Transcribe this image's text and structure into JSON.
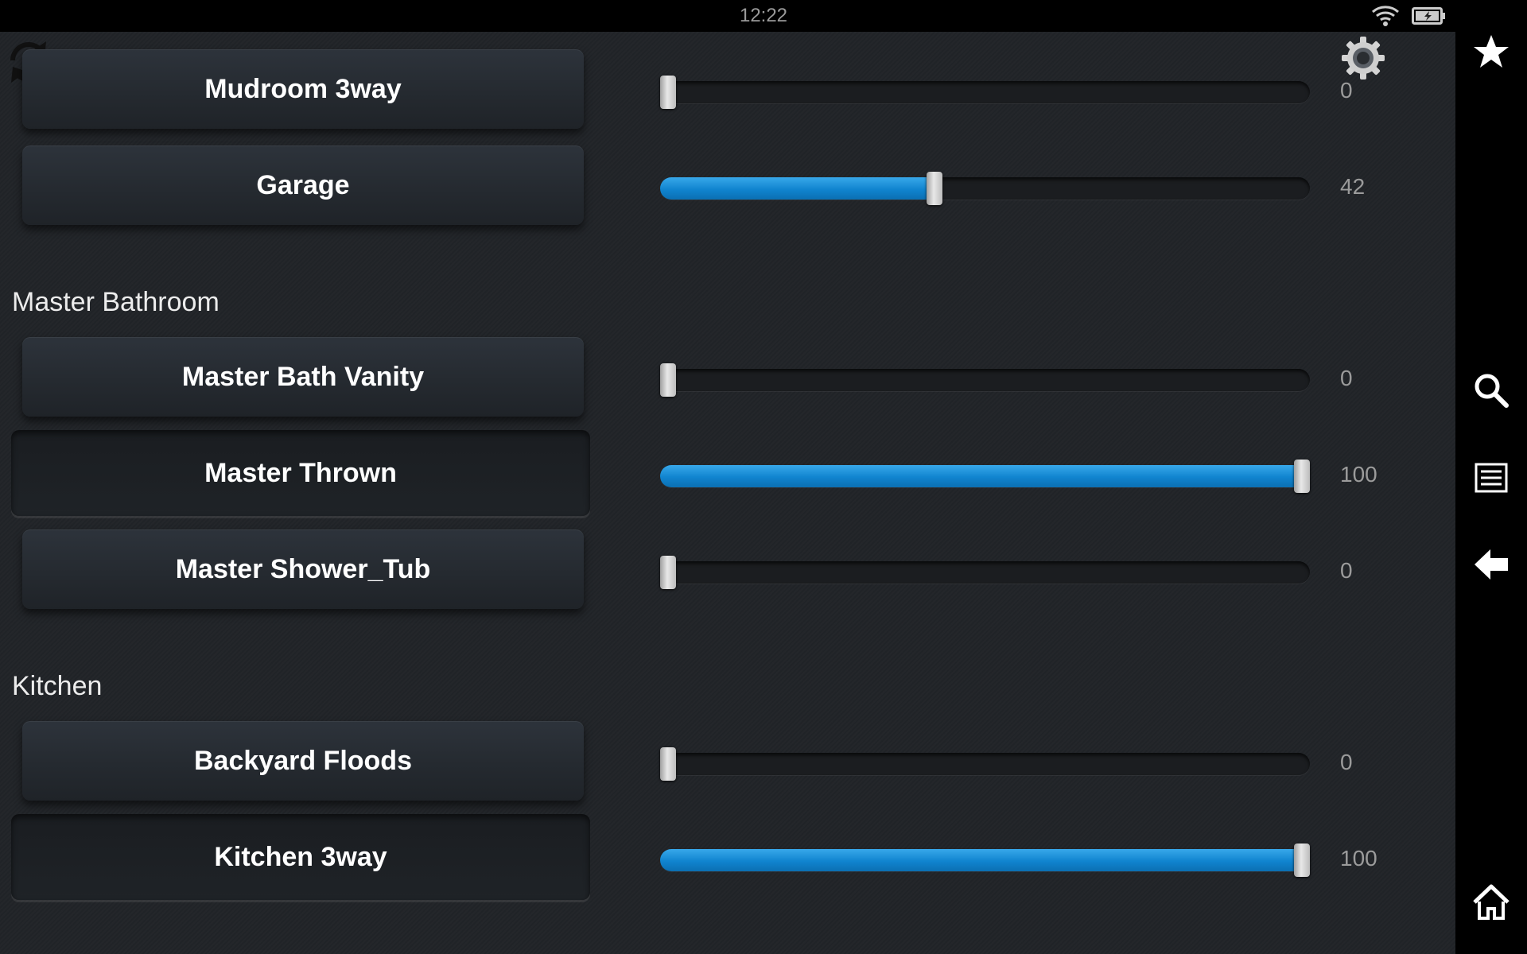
{
  "status_bar": {
    "time": "12:22"
  },
  "groups": [
    {
      "section": "",
      "items": [
        {
          "name": "Mudroom 3way",
          "level": 0,
          "value_text": "0"
        },
        {
          "name": "Garage",
          "level": 42,
          "value_text": "42"
        }
      ]
    },
    {
      "section": "Master Bathroom",
      "items": [
        {
          "name": "Master Bath Vanity",
          "level": 0,
          "value_text": "0"
        },
        {
          "name": "Master Thrown",
          "level": 100,
          "value_text": "100",
          "pressed": true
        },
        {
          "name": "Master Shower_Tub",
          "level": 0,
          "value_text": "0"
        }
      ]
    },
    {
      "section": "Kitchen",
      "items": [
        {
          "name": "Backyard Floods",
          "level": 0,
          "value_text": "0"
        },
        {
          "name": "Kitchen 3way",
          "level": 100,
          "value_text": "100",
          "pressed": true
        }
      ]
    }
  ],
  "icons": {
    "refresh": "refresh-icon",
    "settings": "gear-icon",
    "wifi": "wifi-icon",
    "battery": "battery-icon",
    "favorites": "star-icon",
    "search": "search-icon",
    "menu": "menu-icon",
    "back": "back-arrow-icon",
    "home": "home-icon"
  },
  "colors": {
    "slider_fill": "#1a8fd8",
    "background": "#212428"
  }
}
